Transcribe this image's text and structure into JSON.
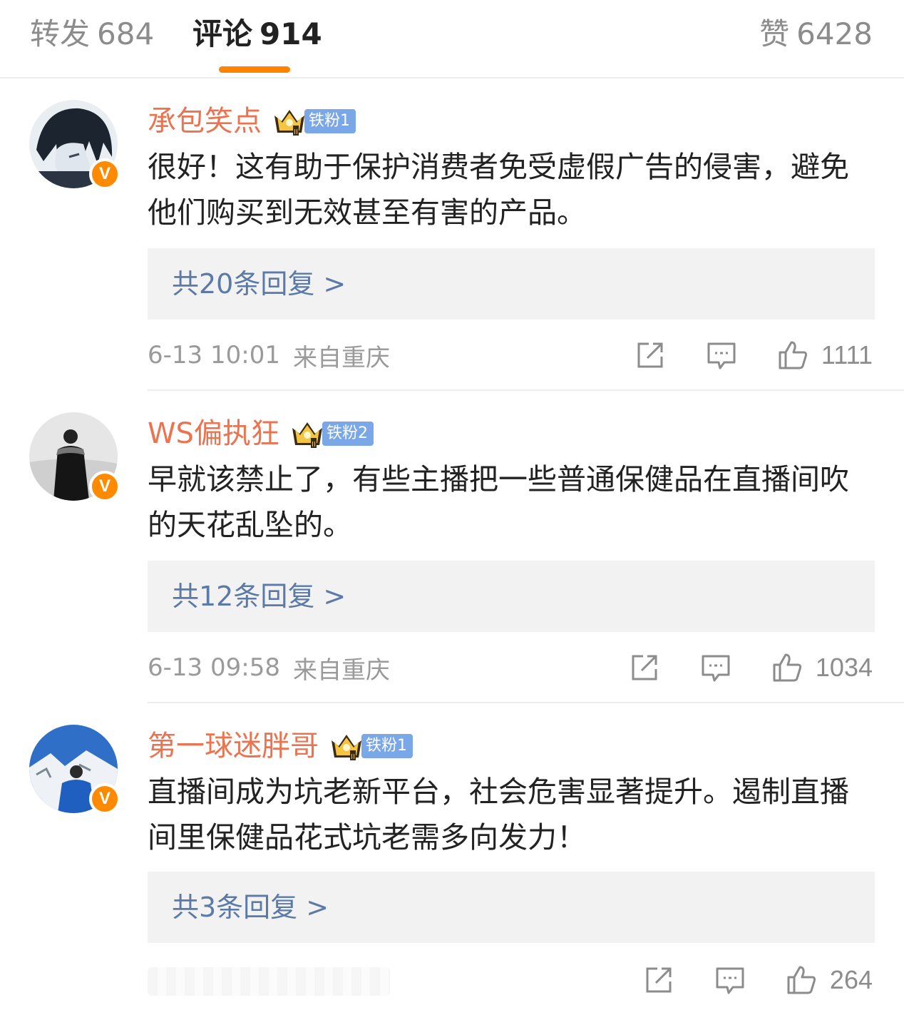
{
  "tabs": {
    "repost": {
      "label": "转发",
      "count": "684"
    },
    "comment": {
      "label": "评论",
      "count": "914"
    },
    "like": {
      "label": "赞",
      "count": "6428"
    }
  },
  "colors": {
    "accent": "#ff8200",
    "username": "#eb7350",
    "reply_link": "#5b7aa8",
    "fan_tag": "#79a7e8",
    "verified": "#ff8a00"
  },
  "comments": [
    {
      "username": "承包笑点",
      "verified_icon": "V",
      "fan_badge": "铁粉1",
      "text": "很好！这有助于保护消费者免受虚假广告的侵害，避免他们购买到无效甚至有害的产品。",
      "replies_label": "共20条回复 >",
      "time": "6-13 10:01",
      "location": "来自重庆",
      "likes": "1111"
    },
    {
      "username": "WS偏执狂",
      "verified_icon": "V",
      "fan_badge": "铁粉2",
      "text": "早就该禁止了，有些主播把一些普通保健品在直播间吹的天花乱坠的。",
      "replies_label": "共12条回复 >",
      "time": "6-13 09:58",
      "location": "来自重庆",
      "likes": "1034"
    },
    {
      "username": "第一球迷胖哥",
      "verified_icon": "V",
      "fan_badge": "铁粉1",
      "text": "直播间成为坑老新平台，社会危害显著提升。遏制直播间里保健品花式坑老需多向发力！",
      "replies_label": "共3条回复 >",
      "likes": "264"
    }
  ],
  "icons": {
    "share": "share-icon",
    "reply": "comment-icon",
    "like": "thumbs-up-icon",
    "crown": "crown-icon"
  }
}
